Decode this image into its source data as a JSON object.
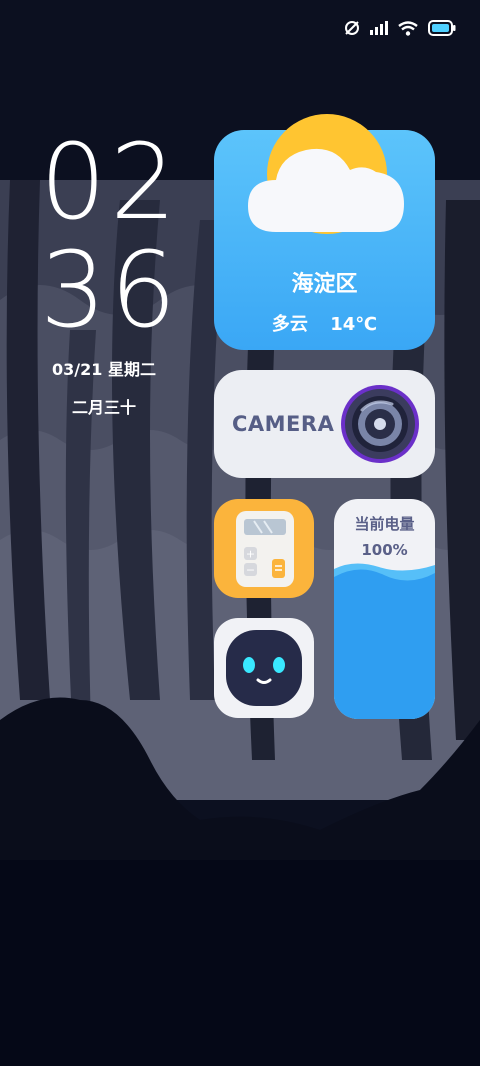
{
  "clock": {
    "hour": "02",
    "minute": "36"
  },
  "date": {
    "gregorian": "03/21 星期二",
    "lunar": "二月三十"
  },
  "weather": {
    "location": "海淀区",
    "condition": "多云",
    "temperature": "14℃",
    "icon": "partly-cloudy-icon"
  },
  "camera": {
    "label": "CAMERA",
    "icon": "camera-lens-icon"
  },
  "calculator": {
    "icon": "calculator-icon"
  },
  "assistant": {
    "icon": "robot-icon"
  },
  "battery": {
    "title": "当前电量",
    "percent": "100%",
    "level": 1.0
  },
  "status_bar": {
    "icons": [
      "no-sim-icon",
      "signal-icon",
      "wifi-icon",
      "battery-icon"
    ]
  },
  "colors": {
    "weather_bg": "#3aa7f5",
    "calculator_bg": "#fbb43c",
    "battery_fill": "#2f9ef1",
    "card_bg": "#eceef3"
  }
}
